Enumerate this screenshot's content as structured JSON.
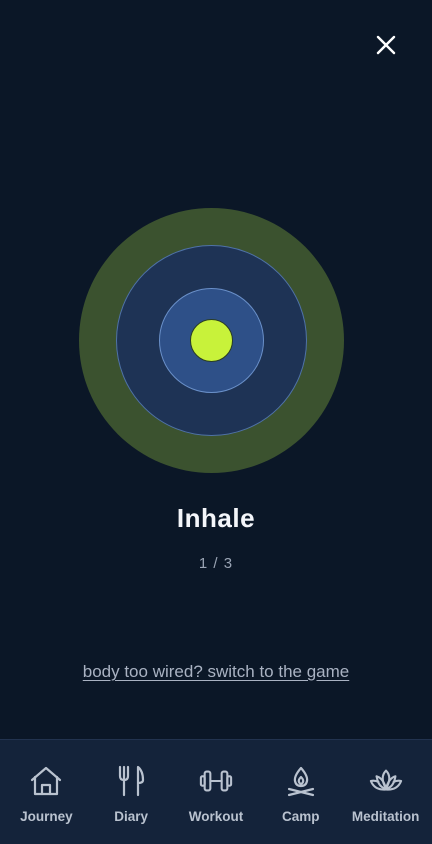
{
  "breathing": {
    "phase": "Inhale",
    "cycle_current": 1,
    "cycle_total": 3,
    "cycle_text": "1 / 3",
    "switch_link": "body too wired? switch to the game"
  },
  "colors": {
    "background": "#0b1727",
    "outer_ring": "#3b522f",
    "middle_ring": "#1e3355",
    "inner_ring": "#2e5088",
    "core": "#c8f23a",
    "nav_background": "#14233a"
  },
  "close_icon": "close-icon",
  "nav": {
    "items": [
      {
        "label": "Journey",
        "icon": "home-icon"
      },
      {
        "label": "Diary",
        "icon": "fork-knife-icon"
      },
      {
        "label": "Workout",
        "icon": "dumbbell-icon"
      },
      {
        "label": "Camp",
        "icon": "campfire-icon"
      },
      {
        "label": "Meditation",
        "icon": "lotus-icon"
      }
    ]
  }
}
